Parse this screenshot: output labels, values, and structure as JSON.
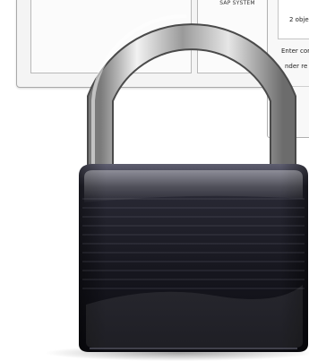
{
  "background_window": {
    "system_label": "SAP SYSTEM",
    "objects_text": "2 obje",
    "enter_text": "Enter cor",
    "under_text": "nder re"
  },
  "padlock": {
    "icon": "padlock-icon",
    "state": "locked",
    "colors": {
      "shackle": "#c9c9c9",
      "body": "#22222e",
      "body_highlight": "#6d6d80"
    }
  }
}
